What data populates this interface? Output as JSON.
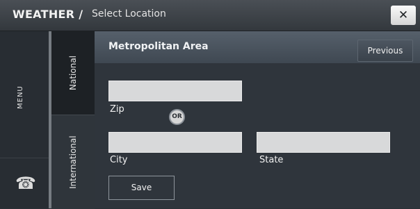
{
  "titlebar": {
    "app_title": "WEATHER /",
    "subtitle": "Select Location",
    "close_icon": "close-icon"
  },
  "sidebar": {
    "menu_label": "MENU",
    "phone_icon": "phone-icon"
  },
  "tabs": [
    {
      "label": "National",
      "selected": true
    },
    {
      "label": "International",
      "selected": false
    }
  ],
  "main": {
    "header_title": "Metropolitan Area",
    "previous_label": "Previous",
    "zip": {
      "label": "Zip",
      "value": ""
    },
    "or_label": "OR",
    "city": {
      "label": "City",
      "value": ""
    },
    "state": {
      "label": "State",
      "value": ""
    },
    "save_label": "Save"
  },
  "colors": {
    "background": "#2b3036",
    "header": "#4b555f",
    "field": "#d8d9da",
    "selected_tab": "#1d2125"
  }
}
